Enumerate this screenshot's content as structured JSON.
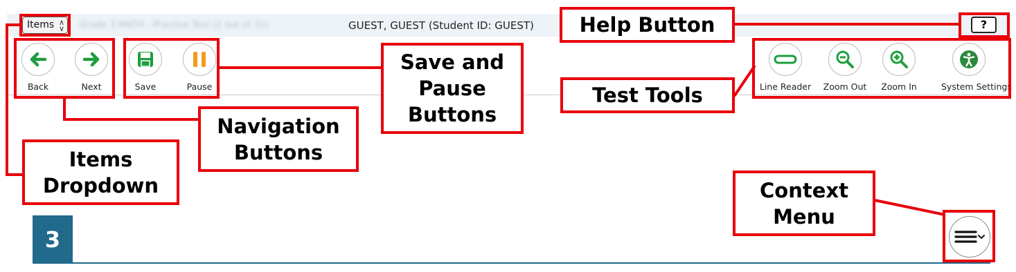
{
  "header": {
    "items_label": "Items",
    "breadcrumb": "Grade 3 MATH - Practice Test (2 out of 31)",
    "student_info": "GUEST, GUEST (Student ID: GUEST)",
    "help_label": "?"
  },
  "toolbar": {
    "back_label": "Back",
    "next_label": "Next",
    "save_label": "Save",
    "pause_label": "Pause",
    "line_reader_label": "Line Reader",
    "zoom_out_label": "Zoom Out",
    "zoom_in_label": "Zoom In",
    "system_settings_label": "System Settings"
  },
  "question": {
    "number": "3"
  },
  "annotations": {
    "help": "Help Button",
    "save_pause_1": "Save and",
    "save_pause_2": "Pause",
    "save_pause_3": "Buttons",
    "test_tools": "Test Tools",
    "navigation_1": "Navigation",
    "navigation_2": "Buttons",
    "items_1": "Items",
    "items_2": "Dropdown",
    "context_1": "Context",
    "context_2": "Menu"
  },
  "colors": {
    "annotation_red": "#e8000b",
    "nav_green": "#1e9e3e",
    "pause_orange": "#f39a1f",
    "question_blue": "#216a8c",
    "settings_green": "#2a8a3c"
  },
  "icons": {
    "back": "arrow-left-icon",
    "next": "arrow-right-icon",
    "save": "floppy-disk-icon",
    "pause": "pause-icon",
    "line_reader": "line-reader-icon",
    "zoom_out": "zoom-out-icon",
    "zoom_in": "zoom-in-icon",
    "system_settings": "accessibility-icon",
    "context_menu": "hamburger-menu-icon"
  }
}
